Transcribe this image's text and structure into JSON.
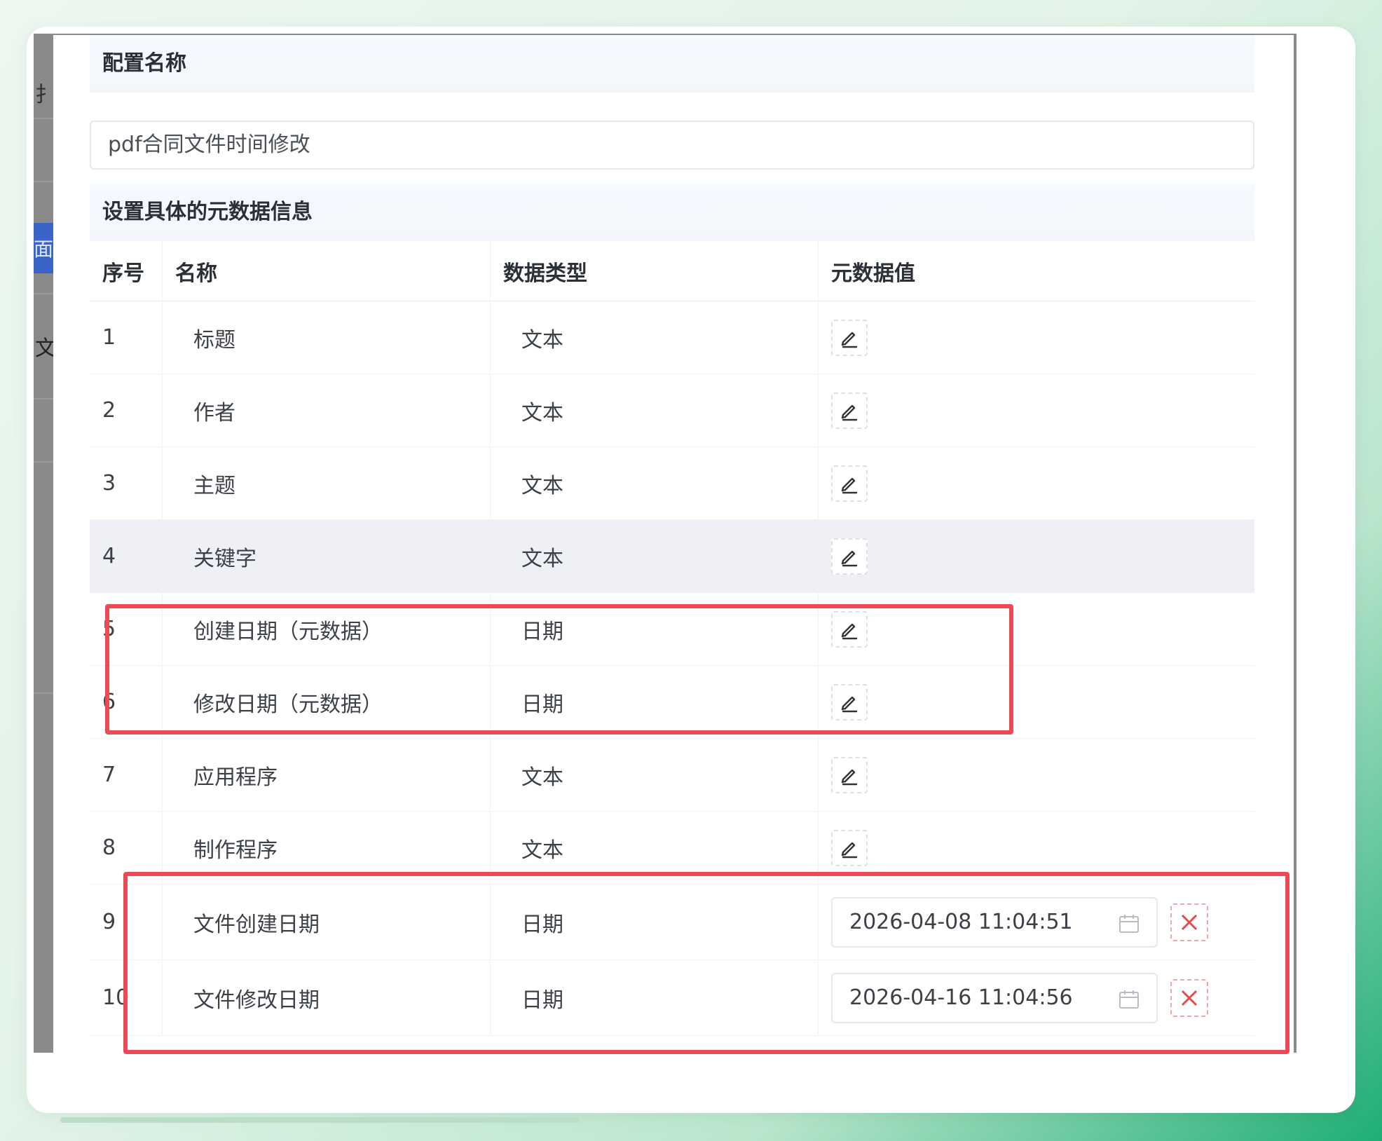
{
  "backdrop": {
    "glyphs": [
      "扌",
      "面板",
      "文"
    ]
  },
  "dialog": {
    "config_section_title": "配置名称",
    "config_name_value": "pdf合同文件时间修改",
    "metadata_section_title": "设置具体的元数据信息"
  },
  "table": {
    "headers": {
      "index": "序号",
      "name": "名称",
      "type": "数据类型",
      "value": "元数据值"
    },
    "rows": [
      {
        "index": "1",
        "name": "标题",
        "type": "文本"
      },
      {
        "index": "2",
        "name": "作者",
        "type": "文本"
      },
      {
        "index": "3",
        "name": "主题",
        "type": "文本"
      },
      {
        "index": "4",
        "name": "关键字",
        "type": "文本"
      },
      {
        "index": "5",
        "name": "创建日期（元数据）",
        "type": "日期"
      },
      {
        "index": "6",
        "name": "修改日期（元数据）",
        "type": "日期"
      },
      {
        "index": "7",
        "name": "应用程序",
        "type": "文本"
      },
      {
        "index": "8",
        "name": "制作程序",
        "type": "文本"
      },
      {
        "index": "9",
        "name": "文件创建日期",
        "type": "日期",
        "date_value": "2026-04-08 11:04:51"
      },
      {
        "index": "10",
        "name": "文件修改日期",
        "type": "日期",
        "date_value": "2026-04-16 11:04:56"
      }
    ]
  },
  "icons": {
    "edit": "pencil-icon",
    "calendar": "calendar-icon",
    "clear": "close-icon"
  },
  "colors": {
    "highlight_border": "#ee4a55",
    "row_hover": "#eef0f6",
    "clear_icon": "#e5484d"
  }
}
